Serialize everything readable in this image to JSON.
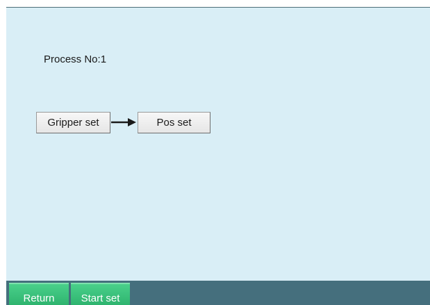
{
  "process": {
    "label": "Process No:1"
  },
  "steps": [
    {
      "label": "Gripper set"
    },
    {
      "label": "Pos set"
    }
  ],
  "nav": {
    "return_label": "Return",
    "start_label": "Start set"
  },
  "colors": {
    "panel_bg": "#d9eef6",
    "bottom_bar": "#456f7d",
    "nav_button": "#3cc27d"
  },
  "icons": {
    "flow_arrow": "arrow-right-icon"
  }
}
